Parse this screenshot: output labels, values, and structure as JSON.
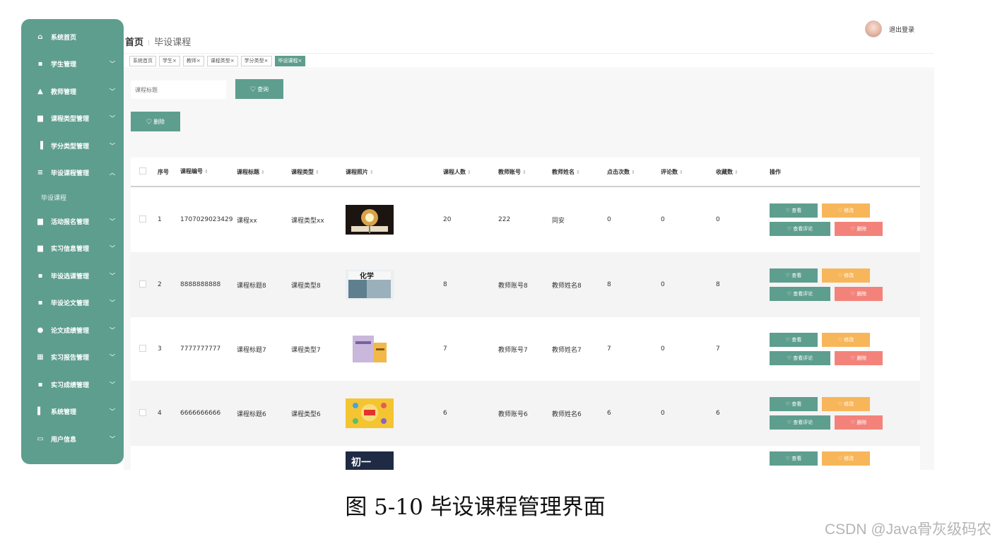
{
  "sidebar": {
    "items": [
      {
        "icon": "home-icon",
        "glyph": "⌂",
        "label": "系统首页",
        "chevron": ""
      },
      {
        "icon": "grid-icon",
        "glyph": "▪",
        "label": "学生管理",
        "chevron": "﹀"
      },
      {
        "icon": "teacher-icon",
        "glyph": "▲",
        "label": "教师管理",
        "chevron": "﹀"
      },
      {
        "icon": "document-icon",
        "glyph": "▆",
        "label": "课程类型管理",
        "chevron": "﹀"
      },
      {
        "icon": "chart-icon",
        "glyph": "▐",
        "label": "学分类型管理",
        "chevron": "﹀"
      },
      {
        "icon": "list-icon",
        "glyph": "≡",
        "label": "毕设课程管理",
        "chevron": "︿"
      }
    ],
    "sub_item": "毕设课程",
    "items_after": [
      {
        "icon": "bookmark-icon",
        "glyph": "▆",
        "label": "活动报名管理",
        "chevron": "﹀"
      },
      {
        "icon": "clipboard-icon",
        "glyph": "▆",
        "label": "实习信息管理",
        "chevron": "﹀"
      },
      {
        "icon": "grid-icon",
        "glyph": "▪",
        "label": "毕设选课管理",
        "chevron": "﹀"
      },
      {
        "icon": "grid-icon",
        "glyph": "▪",
        "label": "毕设论文管理",
        "chevron": "﹀"
      },
      {
        "icon": "location-icon",
        "glyph": "●",
        "label": "论文成绩管理",
        "chevron": "﹀"
      },
      {
        "icon": "table-icon",
        "glyph": "▦",
        "label": "实习报告管理",
        "chevron": "﹀"
      },
      {
        "icon": "grid-icon",
        "glyph": "▪",
        "label": "实习成绩管理",
        "chevron": "﹀"
      },
      {
        "icon": "bar-chart-icon",
        "glyph": "▌",
        "label": "系统管理",
        "chevron": "﹀"
      },
      {
        "icon": "user-card-icon",
        "glyph": "▭",
        "label": "用户信息",
        "chevron": "﹀"
      }
    ]
  },
  "header": {
    "breadcrumb_home": "首页",
    "breadcrumb_sep": "⁝",
    "breadcrumb_current": "毕设课程",
    "logout": "退出登录"
  },
  "tags": [
    {
      "label": "系统首页",
      "active": false
    },
    {
      "label": "学生×",
      "active": false
    },
    {
      "label": "教师×",
      "active": false
    },
    {
      "label": "课程类型×",
      "active": false
    },
    {
      "label": "学分类型×",
      "active": false
    },
    {
      "label": "毕设课程×",
      "active": true
    }
  ],
  "toolbar": {
    "search_placeholder": "课程标题",
    "search_label": "♡ 查询",
    "delete_label": "♡ 删除"
  },
  "table": {
    "sort_glyph": "⇕",
    "headers": [
      "序号",
      "课程编号",
      "课程标题",
      "课程类型",
      "课程照片",
      "课程人数",
      "教师账号",
      "教师姓名",
      "点击次数",
      "评论数",
      "收藏数",
      "操作"
    ],
    "op_labels": {
      "view": "♡ 查看",
      "edit": "♡ 修改",
      "comments": "♡ 查看评论",
      "delete": "♡ 删除"
    },
    "rows": [
      {
        "idx": "1",
        "code": "1707029023429",
        "title": "课程xx",
        "type": "课程类型xx",
        "photo": "book-glow",
        "count": "20",
        "teacher_account": "222",
        "teacher_name": "同安",
        "clicks": "0",
        "comments": "0",
        "favorites": "0"
      },
      {
        "idx": "2",
        "code": "8888888888",
        "title": "课程标题8",
        "type": "课程类型8",
        "photo": "chemistry-book",
        "photo_text": "化学",
        "count": "8",
        "teacher_account": "教师账号8",
        "teacher_name": "教师姓名8",
        "clicks": "8",
        "comments": "0",
        "favorites": "8"
      },
      {
        "idx": "3",
        "code": "7777777777",
        "title": "课程标题7",
        "type": "课程类型7",
        "photo": "purple-books",
        "count": "7",
        "teacher_account": "教师账号7",
        "teacher_name": "教师姓名7",
        "clicks": "7",
        "comments": "0",
        "favorites": "7"
      },
      {
        "idx": "4",
        "code": "6666666666",
        "title": "课程标题6",
        "type": "课程类型6",
        "photo": "yellow-book",
        "count": "6",
        "teacher_account": "教师账号6",
        "teacher_name": "教师姓名6",
        "clicks": "6",
        "comments": "0",
        "favorites": "6"
      },
      {
        "idx": "",
        "code": "",
        "title": "",
        "type": "",
        "photo": "dark-book",
        "photo_text": "初一",
        "count": "",
        "teacher_account": "",
        "teacher_name": "",
        "clicks": "",
        "comments": "",
        "favorites": ""
      }
    ]
  },
  "caption": "图 5-10 毕设课程管理界面",
  "watermark": "CSDN @Java骨灰级码农",
  "colors": {
    "primary": "#5e9e8e",
    "edit": "#f8b65a",
    "delete": "#f3837a"
  }
}
